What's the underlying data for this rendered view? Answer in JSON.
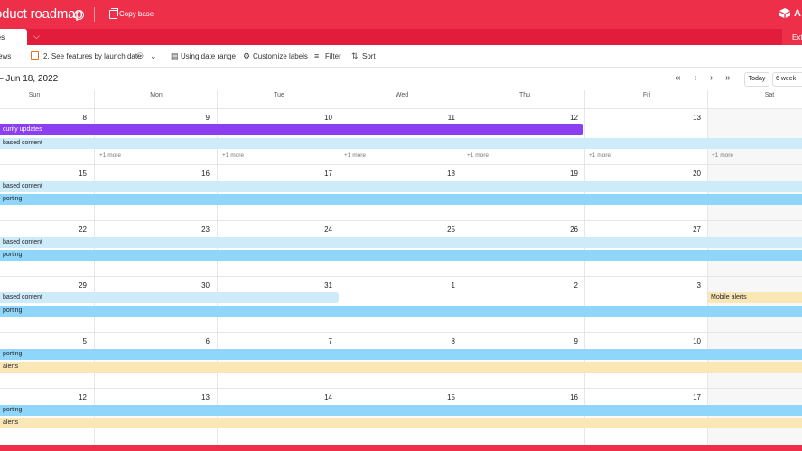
{
  "header": {
    "title": "oduct roadmap",
    "copy_label": "Copy base",
    "logo_text": "A"
  },
  "tabs": {
    "active_label": "res",
    "ext_label": "Ext"
  },
  "toolbar": {
    "views_label": "ews",
    "view_name": "2. See features by launch date",
    "date_range_label": "Using date range",
    "customize_label": "Customize labels",
    "filter_label": "Filter",
    "sort_label": "Sort"
  },
  "calendar": {
    "range_label": "– Jun 18, 2022",
    "today_label": "Today",
    "span_label": "6 week",
    "weekdays": [
      "Sun",
      "Mon",
      "Tue",
      "Wed",
      "Thu",
      "Fri",
      "Sat"
    ],
    "weeks": [
      [
        "8",
        "9",
        "10",
        "11",
        "12",
        "13",
        ""
      ],
      [
        "15",
        "16",
        "17",
        "18",
        "19",
        "20",
        ""
      ],
      [
        "22",
        "23",
        "24",
        "25",
        "26",
        "27",
        ""
      ],
      [
        "29",
        "30",
        "31",
        "1",
        "2",
        "3",
        ""
      ],
      [
        "5",
        "6",
        "7",
        "8",
        "9",
        "10",
        ""
      ],
      [
        "12",
        "13",
        "14",
        "15",
        "16",
        "17",
        ""
      ]
    ],
    "more_label": "+1 more",
    "events": {
      "w1_a": "curity updates",
      "w1_b": "based content",
      "w2_a": "based content",
      "w2_b": "porting",
      "w3_a": "based content",
      "w3_b": "porting",
      "w4_a": "based content",
      "w4_b": "porting",
      "w4_c": "Mobile alerts",
      "w5_a": "porting",
      "w5_b": "alerts",
      "w6_a": "porting",
      "w6_b": "alerts"
    },
    "colors": {
      "purple": "#8b3ff0",
      "light_blue": "#cdebf8",
      "blue": "#8fd6fa",
      "yellow": "#fbe7b5",
      "brand": "#ee2f4a"
    }
  }
}
